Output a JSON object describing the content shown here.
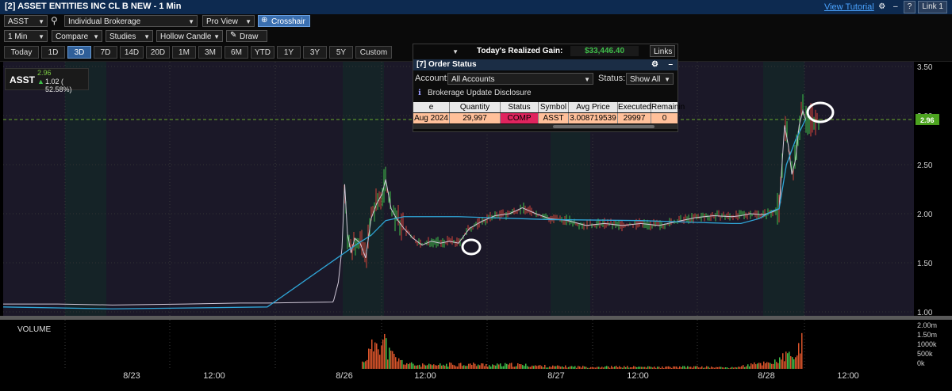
{
  "window": {
    "title": "[2] ASSET ENTITIES INC CL B NEW - 1 Min",
    "view_tutorial": "View Tutorial",
    "link": "Link 1"
  },
  "toolbar": {
    "symbol": "ASST",
    "account": "Individual Brokerage",
    "view": "Pro View",
    "crosshair": "Crosshair",
    "interval": "1 Min",
    "compare": "Compare",
    "studies": "Studies",
    "candle": "Hollow Candle",
    "draw": "Draw"
  },
  "range_tabs": [
    "Today",
    "1D",
    "3D",
    "7D",
    "14D",
    "20D",
    "1M",
    "3M",
    "6M",
    "YTD",
    "1Y",
    "3Y",
    "5Y",
    "Custom"
  ],
  "range_active": "3D",
  "quote": {
    "symbol": "ASST",
    "last": "2.96",
    "change": "1.02 ( 52.58%)"
  },
  "realized": {
    "label": "Today's Realized Gain:",
    "value": "$33,446.40",
    "links": "Links"
  },
  "order_status": {
    "title": "[7] Order Status",
    "account_label": "Account:",
    "account_value": "All Accounts",
    "status_label": "Status:",
    "status_value": "Show All",
    "disclosure": "Brokerage Update Disclosure",
    "columns": [
      "e",
      "Quantity",
      "Status",
      "Symbol",
      "Avg Price",
      "Executed",
      "Remainin"
    ],
    "row": [
      "Aug 2024",
      "29,997",
      "COMP",
      "ASST",
      "3.008719539",
      "29997",
      "0"
    ]
  },
  "chart_data": {
    "type": "line",
    "price_label": "2.96",
    "volume_label": "VOLUME",
    "y_ticks": [
      "3.50",
      "3.00",
      "2.50",
      "2.00",
      "1.50",
      "1.00"
    ],
    "vol_ticks": [
      "2.00m",
      "1.50m",
      "1000k",
      "500k",
      "0k"
    ],
    "x_ticks": [
      "8/23",
      "12:00",
      "8/26",
      "12:00",
      "8/27",
      "12:00",
      "8/28",
      "12:00"
    ],
    "ylim": [
      1.0,
      3.5
    ],
    "price_series": [
      [
        0.0,
        1.08
      ],
      [
        0.06,
        1.08
      ],
      [
        0.12,
        1.07
      ],
      [
        0.2,
        1.08
      ],
      [
        0.26,
        1.09
      ],
      [
        0.29,
        1.09
      ],
      [
        0.362,
        1.1
      ],
      [
        0.363,
        1.12
      ],
      [
        0.368,
        1.3
      ],
      [
        0.372,
        1.65
      ],
      [
        0.375,
        2.3
      ],
      [
        0.378,
        1.8
      ],
      [
        0.382,
        1.6
      ],
      [
        0.386,
        1.75
      ],
      [
        0.392,
        1.7
      ],
      [
        0.398,
        1.55
      ],
      [
        0.404,
        1.95
      ],
      [
        0.41,
        2.1
      ],
      [
        0.416,
        2.2
      ],
      [
        0.42,
        2.35
      ],
      [
        0.426,
        2.05
      ],
      [
        0.432,
        1.95
      ],
      [
        0.44,
        1.85
      ],
      [
        0.45,
        1.75
      ],
      [
        0.46,
        1.68
      ],
      [
        0.47,
        1.72
      ],
      [
        0.48,
        1.7
      ],
      [
        0.49,
        1.72
      ],
      [
        0.5,
        1.7
      ],
      [
        0.512,
        1.85
      ],
      [
        0.525,
        1.92
      ],
      [
        0.54,
        1.98
      ],
      [
        0.556,
        2.0
      ],
      [
        0.57,
        2.06
      ],
      [
        0.585,
        2.0
      ],
      [
        0.6,
        1.95
      ],
      [
        0.62,
        1.93
      ],
      [
        0.64,
        1.88
      ],
      [
        0.66,
        1.9
      ],
      [
        0.68,
        1.88
      ],
      [
        0.7,
        1.9
      ],
      [
        0.72,
        1.88
      ],
      [
        0.74,
        1.92
      ],
      [
        0.76,
        1.96
      ],
      [
        0.78,
        1.98
      ],
      [
        0.8,
        1.97
      ],
      [
        0.81,
        1.98
      ],
      [
        0.82,
        2.0
      ],
      [
        0.835,
        1.99
      ],
      [
        0.845,
        2.02
      ],
      [
        0.852,
        2.05
      ],
      [
        0.858,
        2.9
      ],
      [
        0.862,
        2.7
      ],
      [
        0.866,
        2.4
      ],
      [
        0.87,
        2.55
      ],
      [
        0.874,
        2.9
      ],
      [
        0.878,
        3.05
      ],
      [
        0.881,
        2.96
      ]
    ],
    "avg_series": [
      [
        0.0,
        1.05
      ],
      [
        0.12,
        1.03
      ],
      [
        0.29,
        1.05
      ],
      [
        0.39,
        1.7
      ],
      [
        0.404,
        1.78
      ],
      [
        0.42,
        1.93
      ],
      [
        0.44,
        1.97
      ],
      [
        0.5,
        1.97
      ],
      [
        0.6,
        1.94
      ],
      [
        0.7,
        1.93
      ],
      [
        0.8,
        1.9
      ],
      [
        0.81,
        1.9
      ],
      [
        0.83,
        1.95
      ],
      [
        0.845,
        2.03
      ],
      [
        0.852,
        2.05
      ],
      [
        0.86,
        2.5
      ],
      [
        0.87,
        2.75
      ],
      [
        0.881,
        2.96
      ]
    ],
    "volume_series": [
      [
        0.373,
        0.35
      ],
      [
        0.376,
        0.5
      ],
      [
        0.38,
        0.3
      ],
      [
        0.384,
        0.2
      ],
      [
        0.388,
        0.15
      ],
      [
        0.392,
        0.1
      ],
      [
        0.406,
        0.55
      ],
      [
        0.41,
        0.9
      ],
      [
        0.414,
        0.6
      ],
      [
        0.418,
        0.7
      ],
      [
        0.422,
        0.4
      ],
      [
        0.428,
        0.3
      ],
      [
        0.434,
        0.2
      ],
      [
        0.44,
        0.15
      ],
      [
        0.45,
        0.1
      ],
      [
        0.47,
        0.08
      ],
      [
        0.5,
        0.12
      ],
      [
        0.54,
        0.09
      ],
      [
        0.56,
        0.1
      ],
      [
        0.6,
        0.06
      ],
      [
        0.64,
        0.05
      ],
      [
        0.68,
        0.05
      ],
      [
        0.72,
        0.04
      ],
      [
        0.76,
        0.05
      ],
      [
        0.8,
        0.03
      ],
      [
        0.852,
        0.2
      ],
      [
        0.86,
        0.35
      ],
      [
        0.866,
        0.25
      ],
      [
        0.874,
        0.5
      ],
      [
        0.878,
        0.65
      ]
    ],
    "dashed_level": 2.96
  },
  "colors": {
    "price_line": "#2fa6d8",
    "candle_up": "#3fbf4a",
    "candle_down": "#d4433a",
    "volume": "#d9532a",
    "dash": "#6cab2c",
    "session_a": "#152327",
    "session_b": "#1b1828"
  }
}
